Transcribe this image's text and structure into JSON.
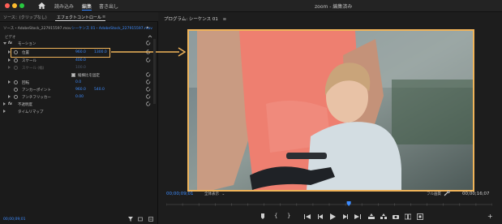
{
  "colors": {
    "accent_blue": "#3d8cff",
    "highlight_orange": "#f0b45a",
    "close": "#ff5f57",
    "minimize": "#febc2e",
    "maximize": "#28c840"
  },
  "window": {
    "title": "zoom - 編集済み",
    "workspace_tabs": [
      "読み込み",
      "編集",
      "書き出し"
    ],
    "active_workspace": "編集"
  },
  "effect_panel": {
    "tabs": [
      "ソース：(クリップなし)",
      "エフェクトコントロール",
      "≡"
    ],
    "source_clip": "ソース・AdobeStock_227915597.mov",
    "sequence_clip": "シーケンス 01・AdobeStock_227915597.mov",
    "section_video": "ビデオ",
    "motion_label": "モーション",
    "position": {
      "label": "位置",
      "x": "960.0",
      "y": "1300.0"
    },
    "scale": {
      "label": "スケール",
      "value": "400.0"
    },
    "scale_width": {
      "label": "スケール (幅)",
      "value": "100.0"
    },
    "uniform_scale": {
      "label": "縦横比を固定",
      "checked": true
    },
    "rotation": {
      "label": "回転",
      "value": "0.0"
    },
    "anchor": {
      "label": "アンカーポイント",
      "x": "960.0",
      "y": "540.0"
    },
    "antiflicker": {
      "label": "アンチフリッカー",
      "value": "0.00"
    },
    "opacity_label": "不透明度",
    "time_remap_label": "タイムリマップ",
    "bottom_timecode": "00;00;09;01"
  },
  "program_monitor": {
    "tab_label": "プログラム: シーケンス 01",
    "tab_menu": "≡",
    "timecode_current": "00;00;09;01",
    "fit_option": "全体表示",
    "quality_option": "フル画質",
    "timecode_duration": "00;00;16;07",
    "playhead_fraction": 0.56
  },
  "icons": {
    "home": "home-icon",
    "filter": "funnel-icon",
    "wrench": "wrench-icon",
    "add": "+"
  }
}
